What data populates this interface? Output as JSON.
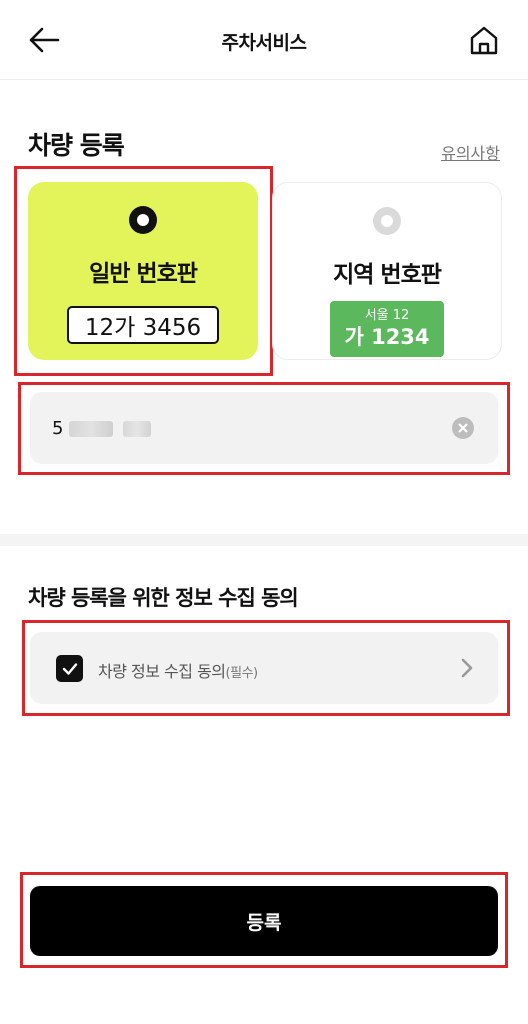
{
  "header": {
    "title": "주차서비스",
    "back_icon": "arrow-left-icon",
    "home_icon": "home-icon"
  },
  "registration": {
    "title": "차량 등록",
    "notice_link": "유의사항",
    "plate_types": [
      {
        "label": "일반 번호판",
        "sample": "12가 3456",
        "selected": true
      },
      {
        "label": "지역 번호판",
        "sample_top": "서울 12",
        "sample_bottom": "가 1234",
        "selected": false
      }
    ],
    "plate_input": {
      "value": "5",
      "value_obscured": true
    }
  },
  "consent": {
    "title": "차량 등록을 위한 정보 수집 동의",
    "item_label": "차량 정보 수집 동의",
    "item_required": "(필수)",
    "checked": true
  },
  "submit": {
    "label": "등록"
  },
  "colors": {
    "selected_card": "#e3f35a",
    "region_plate": "#5cb85c",
    "highlight_box": "#d9262a",
    "primary_button": "#000000"
  }
}
